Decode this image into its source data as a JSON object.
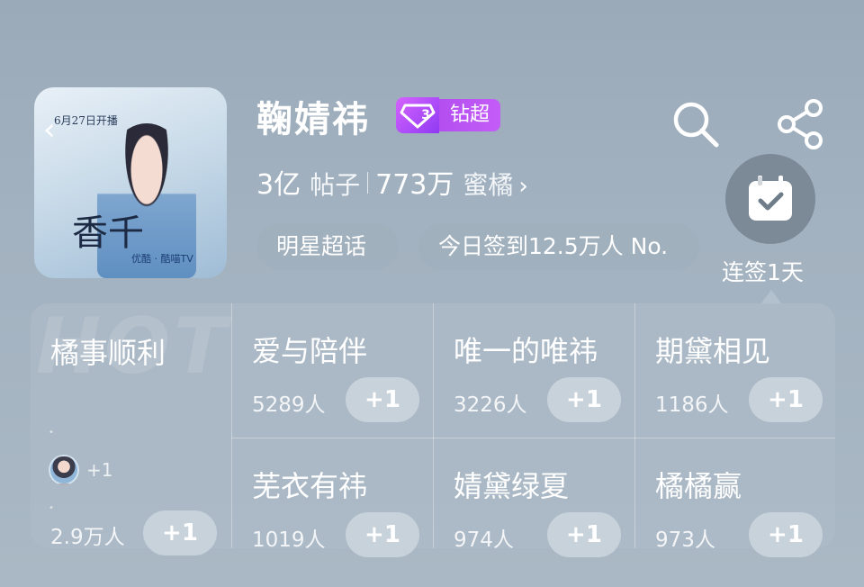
{
  "header": {
    "title": "鞠婧祎",
    "vip_level": "3",
    "vip_label": "钻超",
    "posts_count": "3亿",
    "posts_label": "帖子",
    "fans_count": "773万",
    "fans_label": "蜜橘",
    "fans_chevron": "›"
  },
  "poster": {
    "date_tag": "6月27日开播",
    "calligraphy": "千香",
    "back_chevron": "‹",
    "brand": "优酷 · 酷喵TV"
  },
  "pills": {
    "category": "明星超话",
    "signin": "今日签到12.5万人 No."
  },
  "checkin": {
    "label": "连签1天"
  },
  "colors": {
    "vip_purple": "#b44ff0",
    "background": "#a3b2c0"
  },
  "icons": [
    "back-chevron-icon",
    "search-icon",
    "share-icon",
    "calendar-check-icon",
    "diamond-icon"
  ],
  "grid": {
    "watermark": "HOT",
    "featured": {
      "name": "橘事顺利",
      "plus_small": "+1",
      "count": "2.9万人",
      "plus": "+1"
    },
    "tiles": [
      {
        "name": "爱与陪伴",
        "count": "5289人",
        "plus": "+1"
      },
      {
        "name": "唯一的唯祎",
        "count": "3226人",
        "plus": "+1"
      },
      {
        "name": "期黛相见",
        "count": "1186人",
        "plus": "+1"
      },
      {
        "name": "芜衣有祎",
        "count": "1019人",
        "plus": "+1"
      },
      {
        "name": "婧黛绿夏",
        "count": "974人",
        "plus": "+1"
      },
      {
        "name": "橘橘赢",
        "count": "973人",
        "plus": "+1"
      }
    ]
  }
}
